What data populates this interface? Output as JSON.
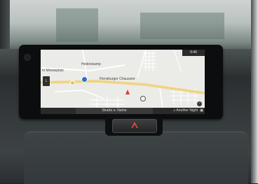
{
  "map": {
    "labels": {
      "neighborhood": "Hedelskamp",
      "district": "m Messeplatz",
      "road": "Flensburger Chaussee",
      "lane": "L"
    },
    "clock": "9:40",
    "street_name": "Straße o. Name",
    "now_playing": "♫ Another Night",
    "icons": {
      "vehicle": "vehicle-position-icon",
      "compass": "compass-icon",
      "poi": "poi-marker-icon",
      "satellite": "satellite-icon"
    },
    "colors": {
      "main_road": "#f2d88f",
      "background": "#ebebe8",
      "vehicle": "#e03a2f",
      "compass": "#2b6ed0"
    }
  },
  "dashboard": {
    "hazard_button": {
      "icon": "hazard-warning-icon"
    }
  }
}
